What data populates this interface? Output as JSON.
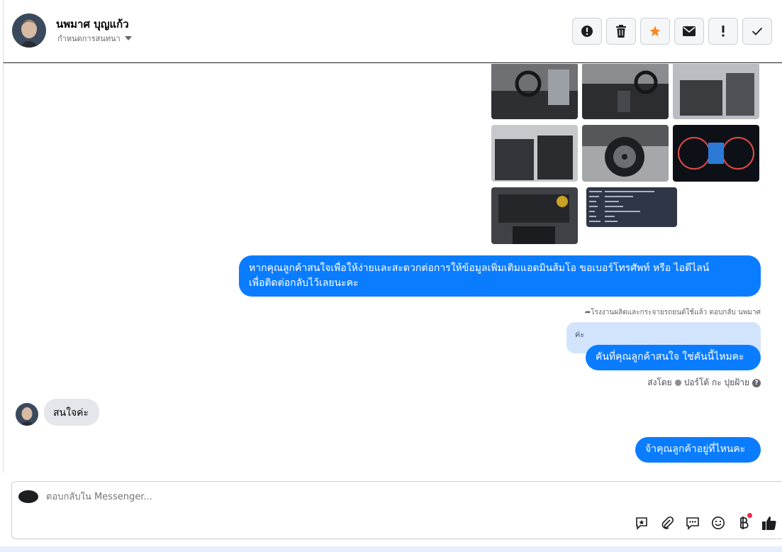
{
  "header": {
    "contact_name": "นพมาศ บุญแก้ว",
    "assign_label": "กำหนดการสนทนา",
    "actions": [
      {
        "name": "report-icon"
      },
      {
        "name": "trash-icon"
      },
      {
        "name": "star-icon",
        "color": "#f58a1f"
      },
      {
        "name": "envelope-icon"
      },
      {
        "name": "exclamation-icon"
      },
      {
        "name": "check-icon"
      }
    ]
  },
  "thread": {
    "photos": [
      "car-interior-steering-photo",
      "car-dashboard-photo",
      "car-rear-seat-photo",
      "car-front-seat-photo",
      "car-wheel-photo",
      "car-gauge-cluster-photo",
      "car-engine-bay-photo",
      "car-spec-sheet-photo"
    ],
    "message_1": "หากคุณลูกค้าสนใจเพื่อให้ง่ายและสะดวกต่อการให้ข้อมูลเพิ่มเติมแอดมินส้มโอ ขอเบอร์โทรศัพท์ หรือ ไอดีไลน์",
    "message_1_line2": "เพื่อติดต่อกลับไว้เลยนะคะ",
    "reply_note": "โรงงานผลิตและกระจายรถยนต์ใช้แล้ว ตอบกลับ นพมาศ",
    "quoted_text": "ค่ะ",
    "message_2": "คันที่คุณลูกค้าสนใจ ใช่คันนี้ไหมคะ",
    "sent_by_prefix": "ส่งโดย",
    "sent_by_name": "ปอร์โต้ กะ ปุยฝ้าย",
    "incoming_message": "สนใจค่ะ",
    "message_3": "จ้าคุณลูกค้าอยู่ที่ไหนคะ"
  },
  "composer": {
    "placeholder": "ตอบกลับใน Messenger...",
    "tools": [
      "saved-reply-icon",
      "attachment-icon",
      "chat-icon",
      "emoji-icon",
      "baht-payment-icon",
      "thumbs-up-icon"
    ],
    "brand_color": "#0a7cff"
  }
}
